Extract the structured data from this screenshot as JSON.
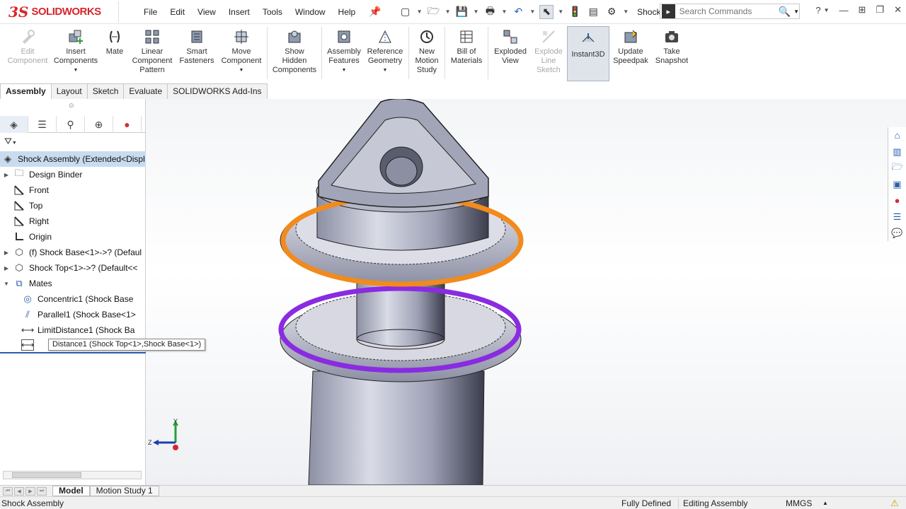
{
  "app": {
    "logo_ds": "3S",
    "logo_text": "SOLIDWORKS",
    "doc_title": "Shock Asse..."
  },
  "menu": [
    "File",
    "Edit",
    "View",
    "Insert",
    "Tools",
    "Window",
    "Help"
  ],
  "search": {
    "placeholder": "Search Commands"
  },
  "ribbon": [
    {
      "label": "Edit Component",
      "icon": "edit-component-icon",
      "enabled": false
    },
    {
      "label": "Insert Components",
      "icon": "insert-components-icon",
      "enabled": true
    },
    {
      "label": "Mate",
      "icon": "mate-icon",
      "enabled": true
    },
    {
      "label": "Linear Component Pattern",
      "icon": "linear-pattern-icon",
      "enabled": true
    },
    {
      "label": "Smart Fasteners",
      "icon": "smart-fasteners-icon",
      "enabled": true
    },
    {
      "label": "Move Component",
      "icon": "move-component-icon",
      "enabled": true
    },
    {
      "label": "Show Hidden Components",
      "icon": "show-hidden-icon",
      "enabled": true
    },
    {
      "label": "Assembly Features",
      "icon": "assembly-features-icon",
      "enabled": true
    },
    {
      "label": "Reference Geometry",
      "icon": "reference-geometry-icon",
      "enabled": true
    },
    {
      "label": "New Motion Study",
      "icon": "motion-study-icon",
      "enabled": true
    },
    {
      "label": "Bill of Materials",
      "icon": "bill-of-materials-icon",
      "enabled": true
    },
    {
      "label": "Exploded View",
      "icon": "exploded-view-icon",
      "enabled": true
    },
    {
      "label": "Explode Line Sketch",
      "icon": "explode-line-sketch-icon",
      "enabled": false
    },
    {
      "label": "Instant3D",
      "icon": "instant3d-icon",
      "enabled": true
    },
    {
      "label": "Update Speedpak",
      "icon": "update-speedpak-icon",
      "enabled": true
    },
    {
      "label": "Take Snapshot",
      "icon": "take-snapshot-icon",
      "enabled": true
    }
  ],
  "tabs": [
    "Assembly",
    "Layout",
    "Sketch",
    "Evaluate",
    "SOLIDWORKS Add-Ins"
  ],
  "tree": {
    "root": "Shock Assembly  (Extended<Displ",
    "items": [
      {
        "label": "Design Binder",
        "icon": "folder-icon",
        "expand": true,
        "level": 0
      },
      {
        "label": "Front",
        "icon": "plane-icon",
        "expand": false,
        "level": 0
      },
      {
        "label": "Top",
        "icon": "plane-icon",
        "expand": false,
        "level": 0
      },
      {
        "label": "Right",
        "icon": "plane-icon",
        "expand": false,
        "level": 0
      },
      {
        "label": "Origin",
        "icon": "origin-icon",
        "expand": false,
        "level": 0
      },
      {
        "label": "(f) Shock Base<1>->? (Defaul",
        "icon": "part-icon",
        "expand": true,
        "level": 0
      },
      {
        "label": "Shock Top<1>->? (Default<<",
        "icon": "part-icon",
        "expand": true,
        "level": 0
      },
      {
        "label": "Mates",
        "icon": "mates-icon",
        "expand": true,
        "level": 0
      },
      {
        "label": "Concentric1 (Shock Base",
        "icon": "concentric-icon",
        "expand": false,
        "level": 1
      },
      {
        "label": "Parallel1 (Shock Base<1>",
        "icon": "parallel-icon",
        "expand": false,
        "level": 1
      },
      {
        "label": "LimitDistance1 (Shock Ba",
        "icon": "limit-distance-icon",
        "expand": false,
        "level": 1
      },
      {
        "label": "",
        "icon": "distance-icon",
        "expand": false,
        "level": 1
      }
    ],
    "tooltip": "Distance1 (Shock Top<1>,Shock Base<1>)"
  },
  "triad": {
    "y": "Y",
    "z": "Z"
  },
  "bottom_tabs": [
    "Model",
    "Motion Study 1"
  ],
  "status": {
    "doc": "Shock Assembly",
    "state": "Fully Defined",
    "mode": "Editing Assembly",
    "units": "MMGS"
  },
  "colors": {
    "orange_ring": "#f28a1c",
    "purple_ring": "#8a2be2",
    "part": "#b9bccb"
  }
}
